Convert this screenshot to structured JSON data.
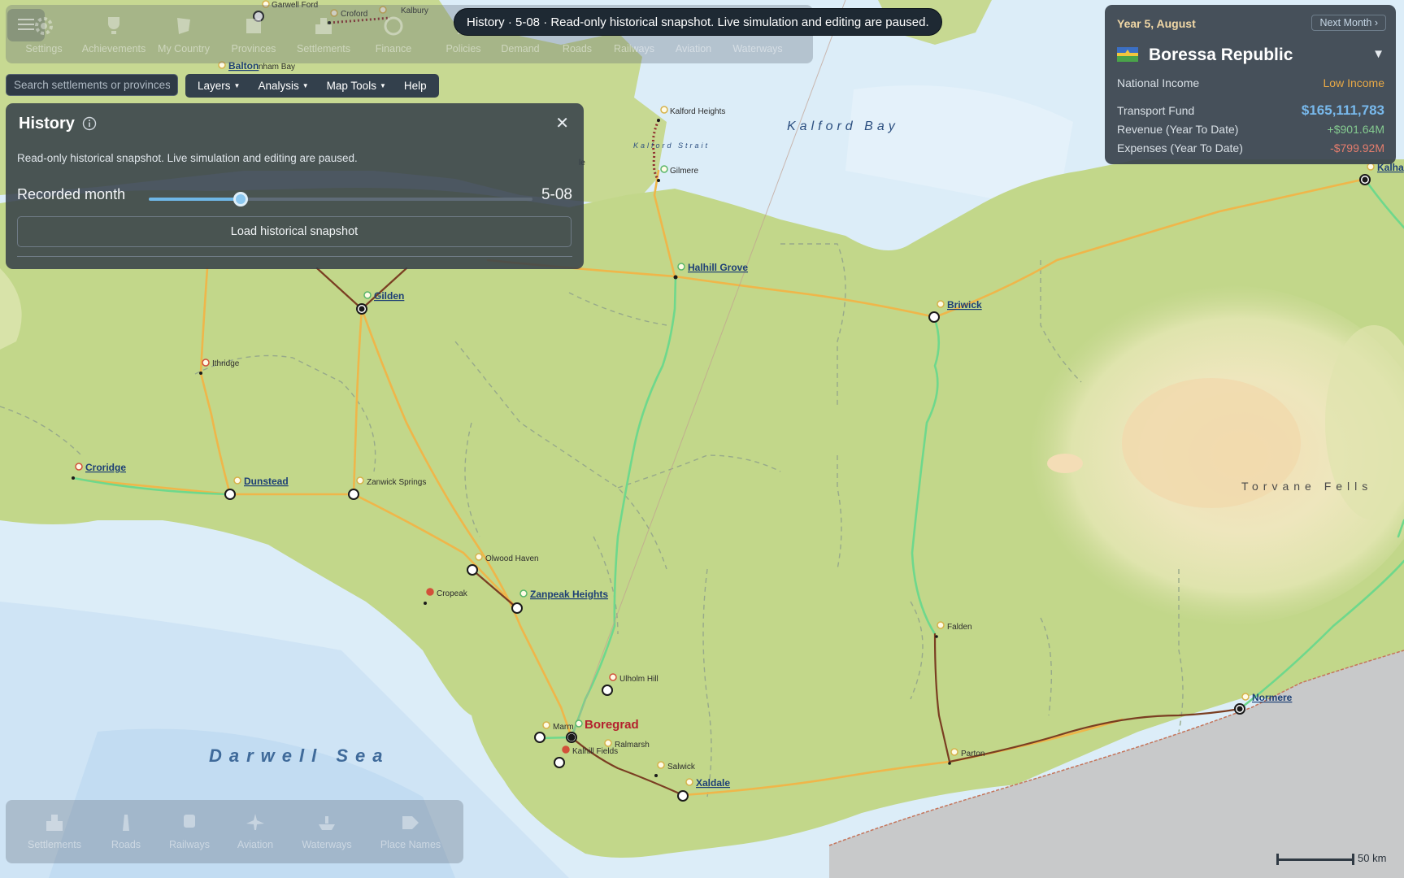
{
  "top_toolbar": {
    "menu_icon": "hamburger-icon",
    "items": [
      {
        "label": "Settings",
        "icon": "gear-icon"
      },
      {
        "label": "Achievements",
        "icon": "trophy-icon"
      },
      {
        "label": "My Country",
        "icon": "country-icon"
      },
      {
        "label": "Provinces",
        "icon": "province-icon"
      },
      {
        "label": "Settlements",
        "icon": "city-icon"
      },
      {
        "label": "Finance",
        "icon": "dollar-icon"
      },
      {
        "label": "Policies",
        "icon": "policy-icon"
      },
      {
        "label": "Demand",
        "icon": "chart-icon"
      },
      {
        "label": "Roads",
        "icon": "road-icon"
      },
      {
        "label": "Railways",
        "icon": "train-icon"
      },
      {
        "label": "Aviation",
        "icon": "plane-icon"
      },
      {
        "label": "Waterways",
        "icon": "ship-icon"
      }
    ]
  },
  "toast": "History · 5-08 · Read-only historical snapshot. Live simulation and editing are paused.",
  "search": {
    "placeholder": "Search settlements or provinces"
  },
  "menubar": {
    "layers": "Layers",
    "analysis": "Analysis",
    "map_tools": "Map Tools",
    "help": "Help"
  },
  "history": {
    "title": "History",
    "description": "Read-only historical snapshot. Live simulation and editing are paused.",
    "recorded_label": "Recorded month",
    "slider_fraction": 0.24,
    "value": "5-08",
    "load_label": "Load historical snapshot"
  },
  "country": {
    "date": "Year 5, August",
    "next_month": "Next Month ›",
    "name": "Boressa Republic",
    "national_income_label": "National Income",
    "national_income_value": "Low Income",
    "fund_label": "Transport Fund",
    "fund_value": "$165,111,783",
    "revenue_label": "Revenue (Year To Date)",
    "revenue_value": "+$901.64M",
    "expenses_label": "Expenses (Year To Date)",
    "expenses_value": "-$799.92M"
  },
  "bottom_toolbar": {
    "items": [
      {
        "label": "Settlements",
        "icon": "city-icon"
      },
      {
        "label": "Roads",
        "icon": "road-icon"
      },
      {
        "label": "Railways",
        "icon": "train-icon"
      },
      {
        "label": "Aviation",
        "icon": "plane-icon"
      },
      {
        "label": "Waterways",
        "icon": "ship-icon"
      },
      {
        "label": "Place Names",
        "icon": "tag-icon"
      }
    ]
  },
  "map": {
    "water_labels": {
      "kalford_bay": "Kalford Bay",
      "kalford_strait": "Kalford Strait",
      "darwell_sea": "Darwell Sea"
    },
    "region_labels": {
      "torvane_fells": "Torvane Fells"
    },
    "settlements": {
      "garwell_ford": "Garwell Ford",
      "croford": "Croford",
      "kalbury": "Kalbury",
      "balton": "Balton",
      "nham_bay": "nham Bay",
      "kalford_heights": "Kalford Heights",
      "gilmere": "Gilmere",
      "halhill_grove": "Halhill Grove",
      "gilden": "Gilden",
      "briwick": "Briwick",
      "ithridge": "Ithridge",
      "croridge": "Croridge",
      "dunstead": "Dunstead",
      "zanwick_springs": "Zanwick Springs",
      "olwood_haven": "Olwood Haven",
      "cropeak": "Cropeak",
      "zanpeak_heights": "Zanpeak Heights",
      "ulholm_hill": "Ulholm Hill",
      "boregrad": "Boregrad",
      "marm": "Marm",
      "kalhill_fields": "Kalhill Fields",
      "ralmarsh": "Ralmarsh",
      "salwick": "Salwick",
      "xaldale": "Xaldale",
      "falden": "Falden",
      "parton": "Parton",
      "normere": "Normere",
      "kalha": "Kalha",
      "le": "le"
    },
    "scale": "50 km"
  }
}
